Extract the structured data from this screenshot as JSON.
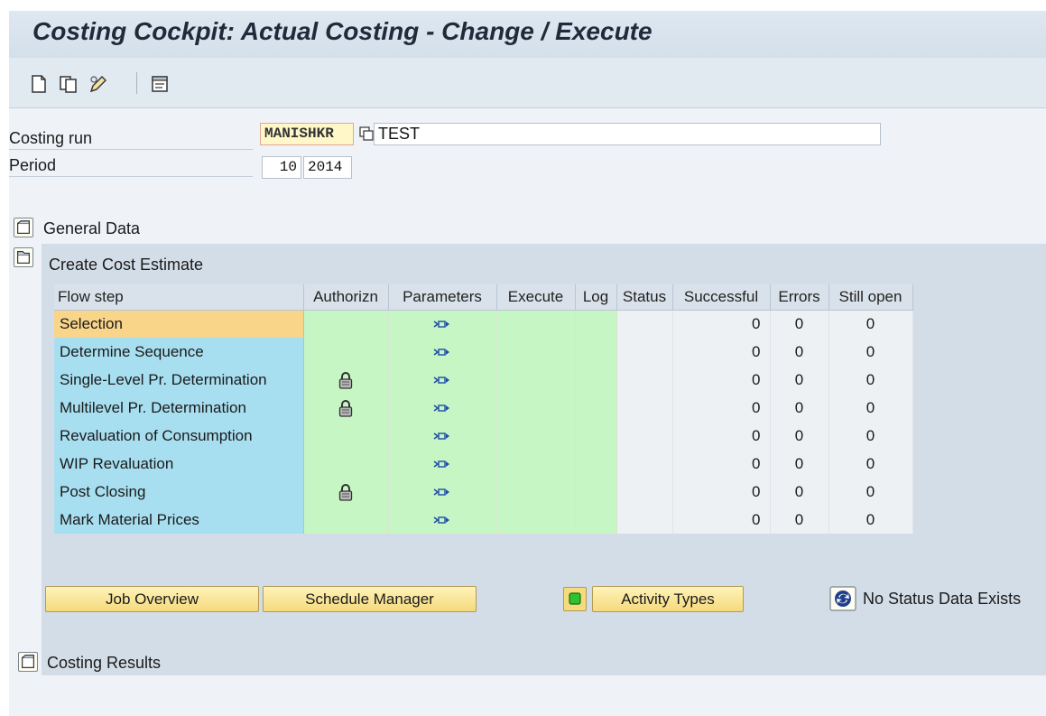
{
  "window": {
    "title": "Costing Cockpit: Actual Costing - Change / Execute"
  },
  "toolbar": {
    "icons": [
      "new-document-icon",
      "copy-icon",
      "edit-pencil-icon",
      "display-list-icon"
    ]
  },
  "header": {
    "costing_run_label": "Costing run",
    "costing_run_value": "MANISHKR",
    "costing_run_desc": "TEST",
    "period_label": "Period",
    "period_month": "10",
    "period_year": "2014"
  },
  "trays": {
    "general_data": "General Data",
    "create_cost_estimate": "Create Cost Estimate",
    "costing_results": "Costing Results"
  },
  "flow_table": {
    "columns": [
      "Flow step",
      "Authorizn",
      "Parameters",
      "Execute",
      "Log",
      "Status",
      "Successful",
      "Errors",
      "Still open"
    ],
    "rows": [
      {
        "step": "Selection",
        "locked": false,
        "successful": "0",
        "errors": "0",
        "open": "0"
      },
      {
        "step": "Determine Sequence",
        "locked": false,
        "successful": "0",
        "errors": "0",
        "open": "0"
      },
      {
        "step": "Single-Level Pr. Determination",
        "locked": true,
        "successful": "0",
        "errors": "0",
        "open": "0"
      },
      {
        "step": "Multilevel Pr. Determination",
        "locked": true,
        "successful": "0",
        "errors": "0",
        "open": "0"
      },
      {
        "step": "Revaluation of Consumption",
        "locked": false,
        "successful": "0",
        "errors": "0",
        "open": "0"
      },
      {
        "step": "WIP Revaluation",
        "locked": false,
        "successful": "0",
        "errors": "0",
        "open": "0"
      },
      {
        "step": "Post Closing",
        "locked": true,
        "successful": "0",
        "errors": "0",
        "open": "0"
      },
      {
        "step": "Mark Material Prices",
        "locked": false,
        "successful": "0",
        "errors": "0",
        "open": "0"
      }
    ]
  },
  "buttons": {
    "job_overview": "Job Overview",
    "schedule_manager": "Schedule Manager",
    "activity_types": "Activity Types"
  },
  "status": {
    "message": "No Status Data Exists"
  },
  "colors": {
    "selected_row": "#f9d589",
    "flow_step_bg": "#a8dff0",
    "green_cells": "#c7f6c5",
    "button_bg": "#f5da7e"
  }
}
